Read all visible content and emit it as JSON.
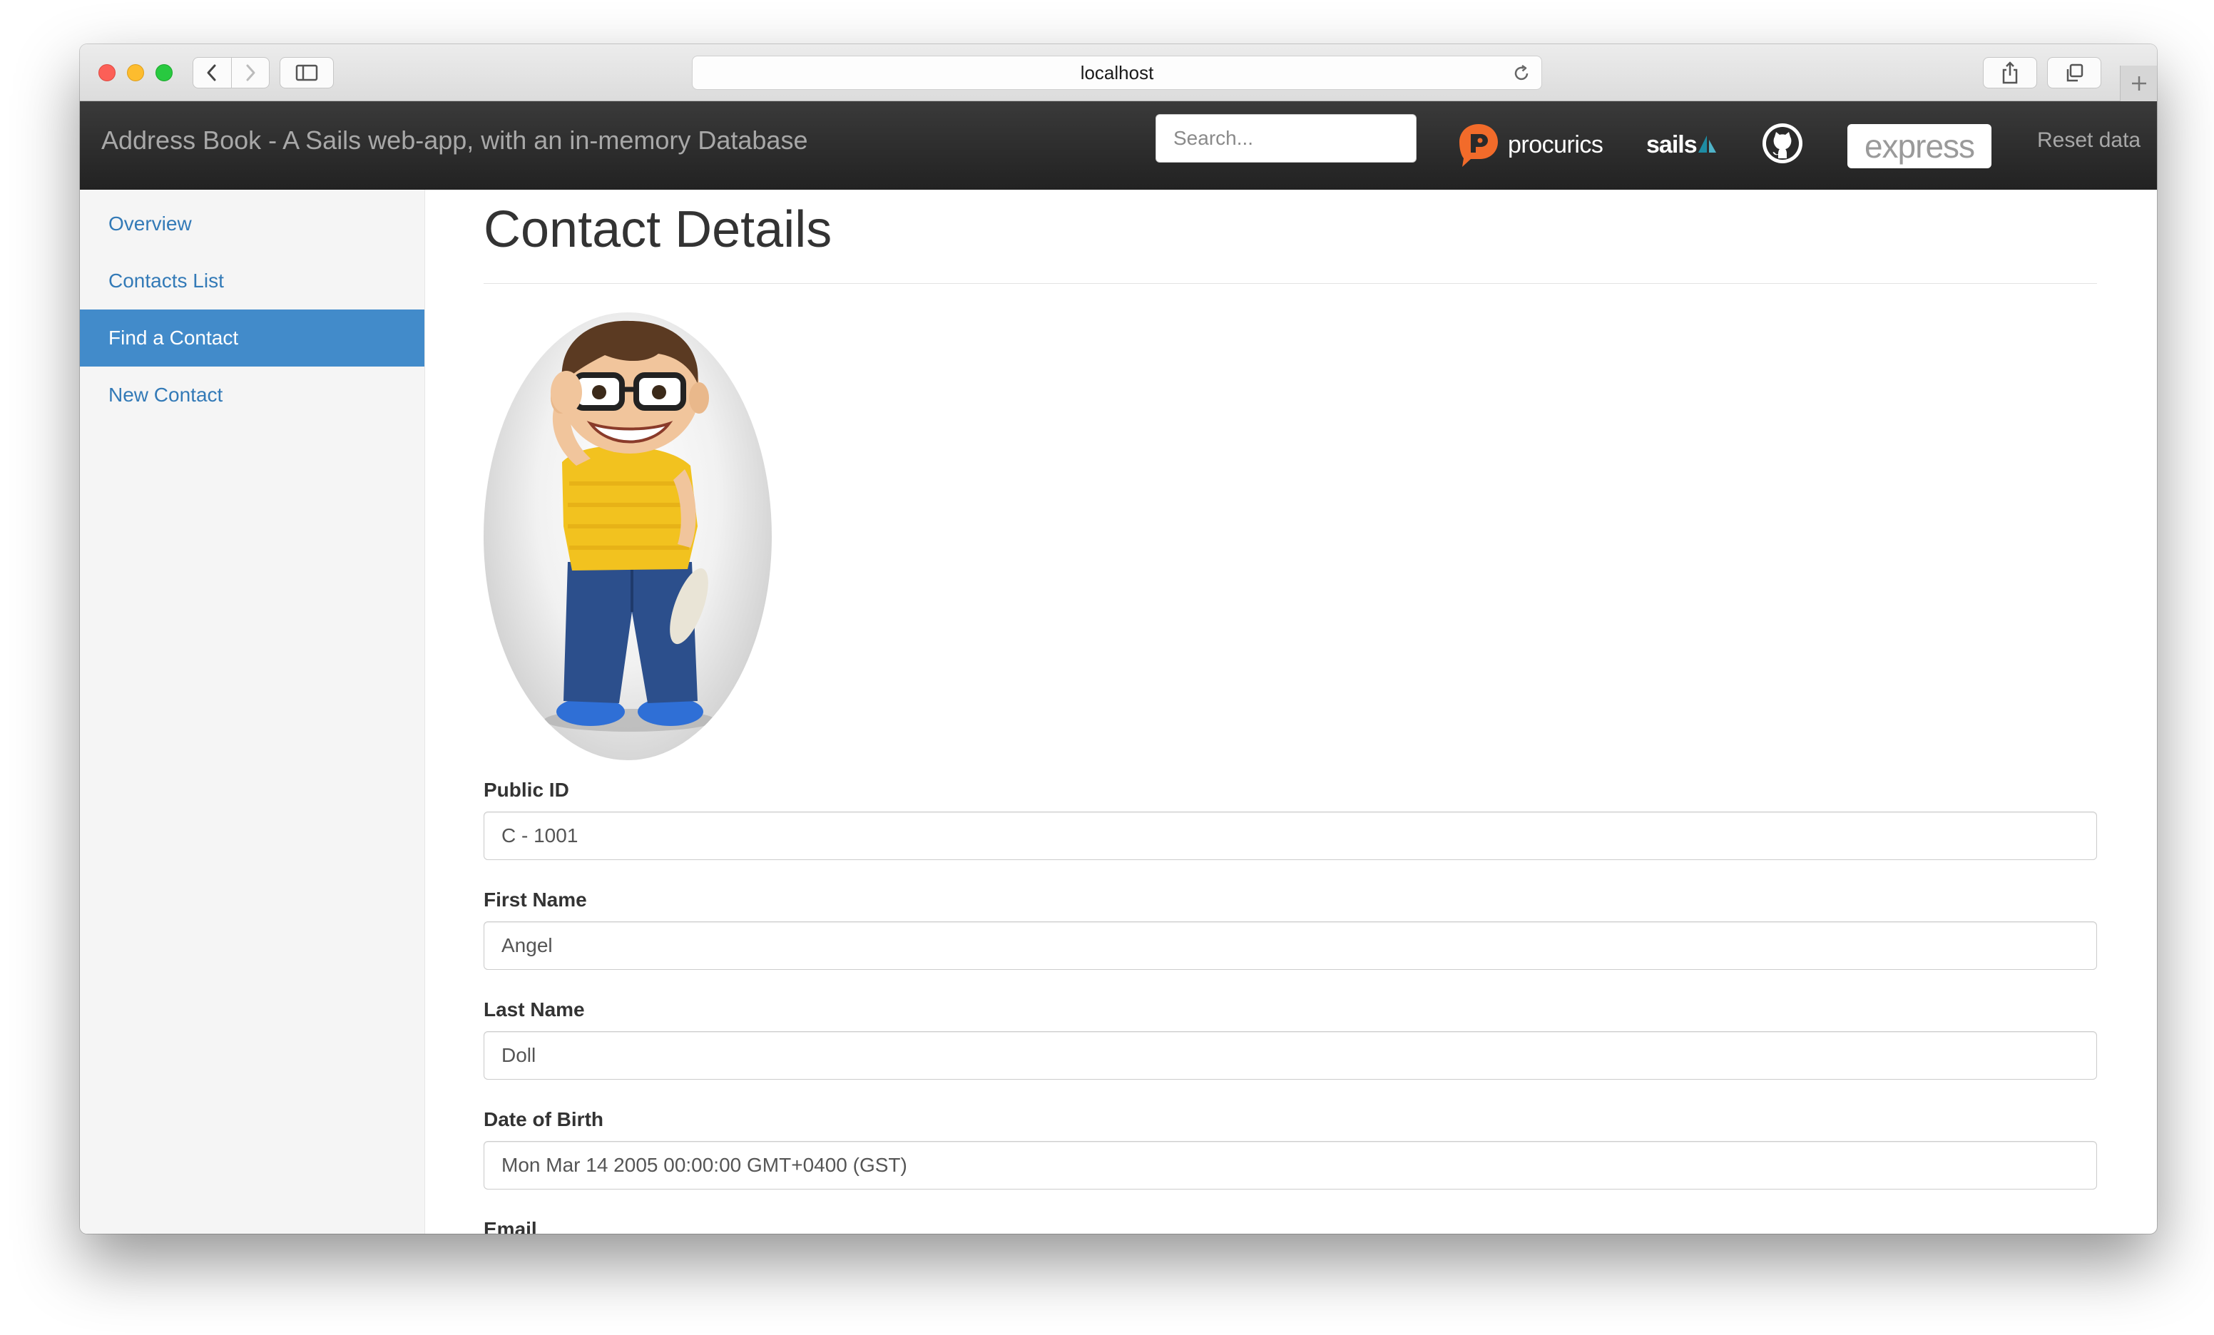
{
  "browser": {
    "url": "localhost"
  },
  "navbar": {
    "brand": "Address Book - A Sails web-app, with an in-memory Database",
    "search_placeholder": "Search...",
    "logos": {
      "procurics": "procurics",
      "sails": "sails",
      "express": "express"
    },
    "reset_label": "Reset data"
  },
  "sidebar": {
    "items": [
      {
        "label": "Overview",
        "active": false
      },
      {
        "label": "Contacts List",
        "active": false
      },
      {
        "label": "Find a Contact",
        "active": true
      },
      {
        "label": "New Contact",
        "active": false
      }
    ]
  },
  "main": {
    "title": "Contact Details",
    "fields": [
      {
        "label": "Public ID",
        "value": "C - 1001"
      },
      {
        "label": "First Name",
        "value": "Angel"
      },
      {
        "label": "Last Name",
        "value": "Doll"
      },
      {
        "label": "Date of Birth",
        "value": "Mon Mar 14 2005 00:00:00 GMT+0400 (GST)"
      },
      {
        "label": "Email",
        "value": ""
      }
    ]
  },
  "colors": {
    "navbar": "#222222",
    "link": "#337ab7",
    "active_item": "#428bca",
    "procurics_orange": "#f26b2a",
    "sails_teal": "#1e8ca3"
  }
}
